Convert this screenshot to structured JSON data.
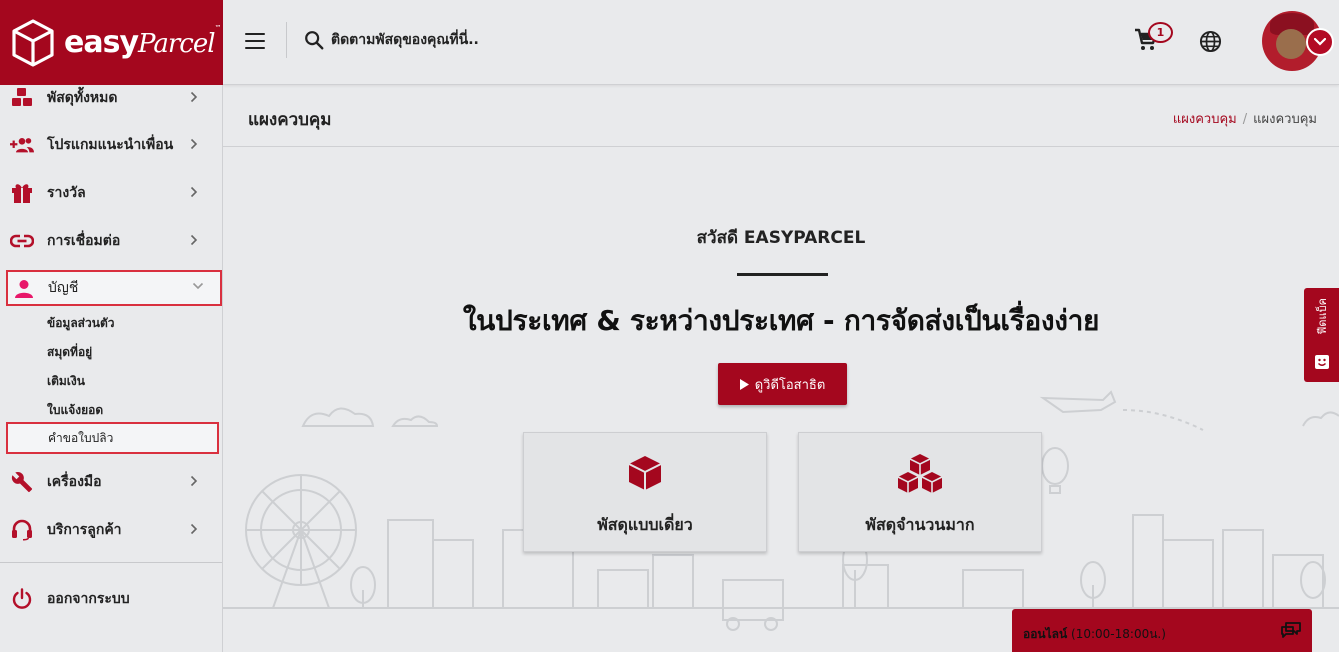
{
  "brand": {
    "name_easy": "easy",
    "name_parcel": "Parcel",
    "tm": "™"
  },
  "header": {
    "search_placeholder": "ติดตามพัสดุของคุณที่นี่..",
    "cart_count": "1"
  },
  "sidebar": {
    "items": [
      {
        "label": "พัสดุทั้งหมด",
        "icon": "boxes-icon"
      },
      {
        "label": "โปรแกมแนะนำเพื่อน",
        "icon": "add-people-icon"
      },
      {
        "label": "รางวัล",
        "icon": "gift-icon"
      },
      {
        "label": "การเชื่อมต่อ",
        "icon": "link-icon"
      },
      {
        "label": "บัญชี",
        "icon": "person-icon"
      },
      {
        "label": "เครื่องมือ",
        "icon": "wrench-icon"
      },
      {
        "label": "บริการลูกค้า",
        "icon": "headset-icon"
      }
    ],
    "account_sub": [
      "ข้อมูลส่วนตัว",
      "สมุดที่อยู่",
      "เติมเงิน",
      "ใบแจ้งยอด",
      "คำขอใบปลิว"
    ],
    "logout": "ออกจากระบบ"
  },
  "page": {
    "title": "แผงควบคุม",
    "breadcrumb": [
      "แผงควบคุม",
      "/",
      "แผงควบคุม"
    ]
  },
  "main": {
    "greeting": "สวัสดี EASYPARCEL",
    "headline": "ในประเทศ & ระหว่างประเทศ - การจัดส่งเป็นเรื่องง่าย",
    "video_button": "ดูวิดีโอสาธิต",
    "cards": [
      {
        "label": "พัสดุแบบเดี่ยว",
        "icon": "single-box-icon"
      },
      {
        "label": "พัสดุจำนวนมาก",
        "icon": "multiple-boxes-icon"
      }
    ]
  },
  "feedback": {
    "label": "ฟีดแบ็ค"
  },
  "chat": {
    "status": "ออนไลน์",
    "hours": "(10:00-18:00น.)"
  },
  "colors": {
    "brand_red": "#a4071e",
    "highlight_border": "#d9303f",
    "page_bg": "#e9eaec"
  }
}
